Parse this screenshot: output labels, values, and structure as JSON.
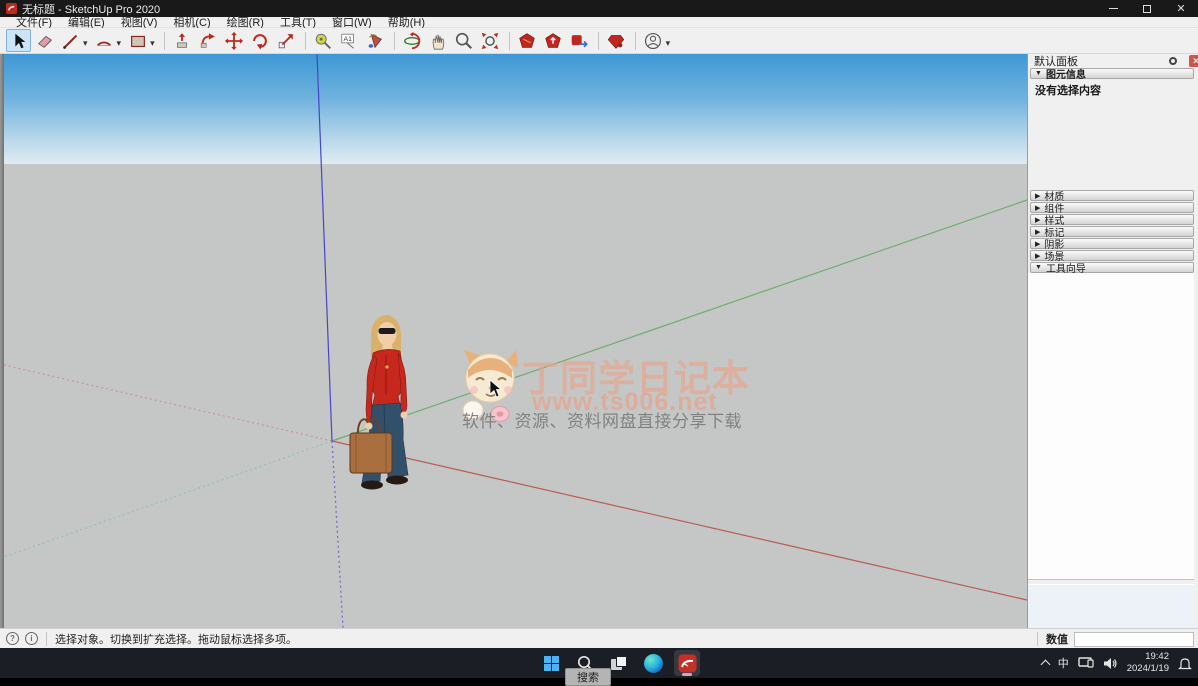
{
  "titlebar": {
    "title": "无标题 - SketchUp Pro 2020"
  },
  "menu": {
    "items": [
      "文件(F)",
      "编辑(E)",
      "视图(V)",
      "相机(C)",
      "绘图(R)",
      "工具(T)",
      "窗口(W)",
      "帮助(H)"
    ]
  },
  "icons": {
    "dropdown": "▾",
    "collapsed": "▶",
    "expanded": "▼",
    "close": "✕",
    "text_tool_label": "A1",
    "status_help": "i",
    "status_geo": "?"
  },
  "panel": {
    "title": "默认面板",
    "entity_info_label": "图元信息",
    "no_selection": "没有选择内容",
    "sections": [
      "材质",
      "组件",
      "样式",
      "标记",
      "阴影",
      "场景"
    ],
    "instructor_label": "工具向导"
  },
  "status": {
    "hint": "选择对象。切换到扩充选择。拖动鼠标选择多项。",
    "measurement_label": "数值",
    "measurement_value": ""
  },
  "watermark": {
    "title": "丁同学日记本",
    "url": "www.ts006.net",
    "subtitle": "软件、资源、资料网盘直接分享下载"
  },
  "taskbar": {
    "tooltip": "搜索",
    "ime_indicator": "中",
    "time": "19:42",
    "date": "2024/1/19"
  },
  "colors": {
    "sketchup_red": "#c0281e",
    "axis_red": "#b85c52",
    "axis_green": "#6fae6f",
    "axis_blue": "#4545c8",
    "sky_top": "#3e98d5",
    "ground": "#c5c6c6"
  }
}
